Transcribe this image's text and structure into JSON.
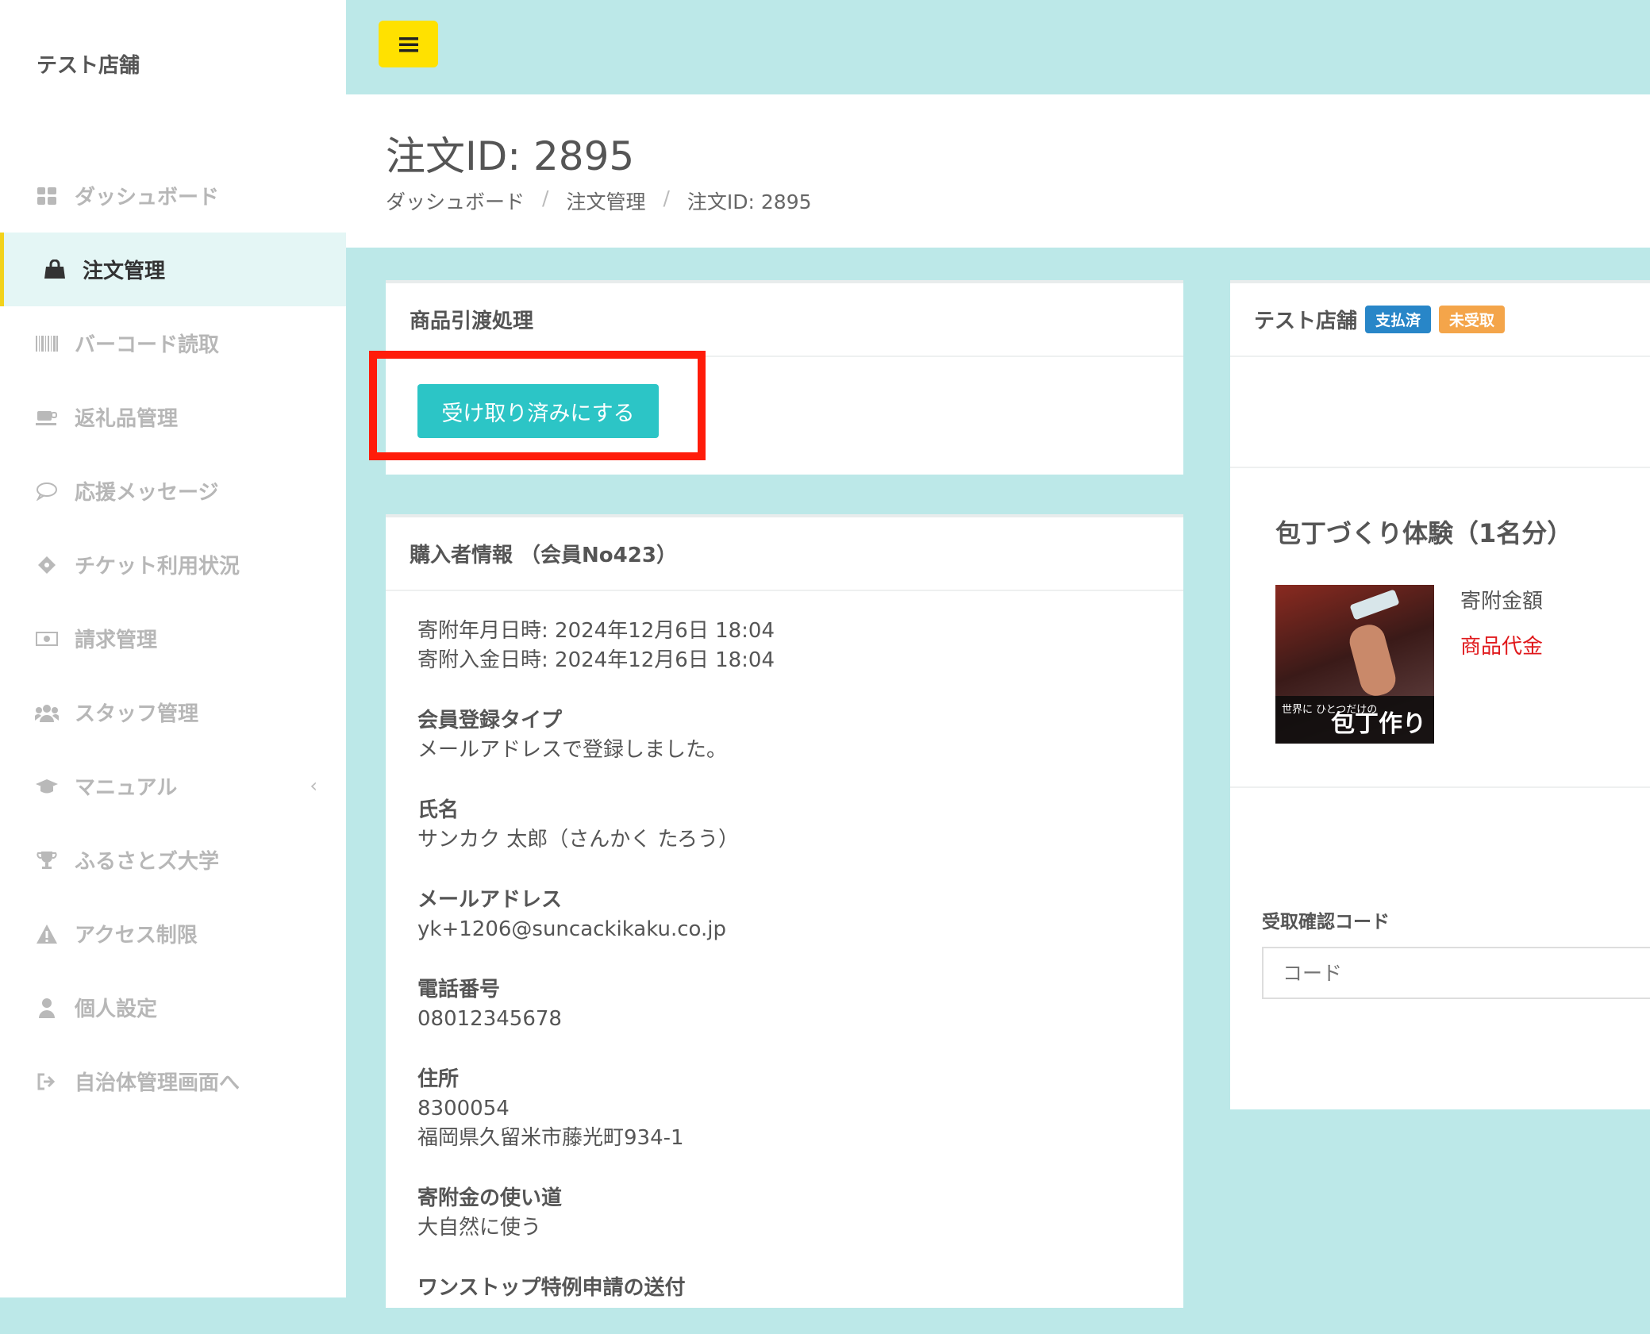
{
  "brand": "テスト店舗",
  "sidebar": {
    "items": [
      {
        "label": "ダッシュボード",
        "icon": "dashboard-icon"
      },
      {
        "label": "注文管理",
        "icon": "shopping-bag-icon",
        "active": true
      },
      {
        "label": "バーコード読取",
        "icon": "barcode-icon"
      },
      {
        "label": "返礼品管理",
        "icon": "gift-icon"
      },
      {
        "label": "応援メッセージ",
        "icon": "chat-icon"
      },
      {
        "label": "チケット利用状況",
        "icon": "ticket-icon"
      },
      {
        "label": "請求管理",
        "icon": "money-icon"
      },
      {
        "label": "スタッフ管理",
        "icon": "users-icon"
      },
      {
        "label": "マニュアル",
        "icon": "graduation-cap-icon"
      },
      {
        "label": "ふるさとズ大学",
        "icon": "trophy-icon"
      },
      {
        "label": "アクセス制限",
        "icon": "warning-icon"
      },
      {
        "label": "個人設定",
        "icon": "user-icon"
      },
      {
        "label": "自治体管理画面へ",
        "icon": "sign-out-icon"
      }
    ],
    "expand_chevron": "‹"
  },
  "page": {
    "title": "注文ID: 2895",
    "breadcrumb": [
      "ダッシュボード",
      "注文管理",
      "注文ID: 2895"
    ],
    "breadcrumb_sep": "/"
  },
  "delivery_card": {
    "title": "商品引渡処理",
    "button": "受け取り済みにする"
  },
  "buyer_card": {
    "title": "購入者情報 （会員No423）",
    "donation_datetime": "寄附年月日時: 2024年12月6日 18:04",
    "payment_datetime": "寄附入金日時: 2024年12月6日 18:04",
    "fields": [
      {
        "label": "会員登録タイプ",
        "value": "メールアドレスで登録しました。"
      },
      {
        "label": "氏名",
        "value": "サンカク 太郎（さんかく たろう）"
      },
      {
        "label": "メールアドレス",
        "value": "yk+1206@suncackikaku.co.jp"
      },
      {
        "label": "電話番号",
        "value": "08012345678"
      }
    ],
    "address_label": "住所",
    "postal_code": "8300054",
    "address": "福岡県久留米市藤光町934-1",
    "usage_label": "寄附金の使い道",
    "usage_value": "大自然に使う",
    "onestop_label": "ワンストップ特例申請の送付"
  },
  "shop_card": {
    "title": "テスト店舗",
    "badges": {
      "paid": "支払済",
      "unreceived": "未受取"
    },
    "colors": {
      "paid": "#2886c8",
      "unreceived": "#f4a54a"
    },
    "product_name": "包丁づくり体験（1名分）",
    "product_image_text_small": "世界に ひとつだけの",
    "product_image_text_big": "包丁作り体験",
    "donation_amount_label": "寄附金額",
    "product_price_label": "商品代金",
    "code_label": "受取確認コード",
    "code_placeholder": "コード"
  }
}
